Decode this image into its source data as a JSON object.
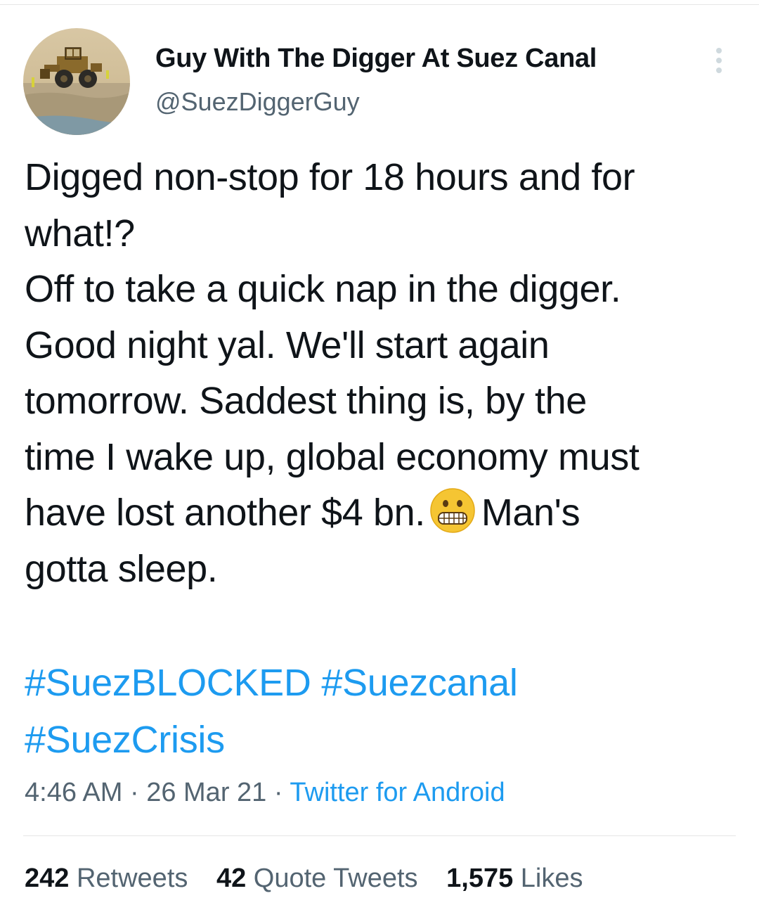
{
  "author": {
    "display_name": "Guy With The Digger At Suez Canal",
    "handle": "@SuezDiggerGuy",
    "avatar_icon": "digger-photo"
  },
  "tweet": {
    "lines": [
      "Digged non-stop for 18 hours and for",
      "what!?",
      "Off to take a quick nap in the digger.",
      "Good night yal. We'll start again",
      "tomorrow. Saddest thing is, by the",
      "time I wake up, global economy must"
    ],
    "line7_before": "have lost another $4 bn.",
    "emoji": "grimacing-face",
    "line7_after": "Man's",
    "line8": "gotta sleep.",
    "hashtags": [
      "#SuezBLOCKED",
      "#Suezcanal",
      "#SuezCrisis"
    ]
  },
  "meta": {
    "time": "4:46 AM",
    "separator": "·",
    "date": "26 Mar 21",
    "source": "Twitter for Android"
  },
  "stats": {
    "retweets_count": "242",
    "retweets_label": "Retweets",
    "quotes_count": "42",
    "quotes_label": "Quote Tweets",
    "likes_count": "1,575",
    "likes_label": "Likes"
  },
  "colors": {
    "link": "#1d9bf0",
    "secondary_text": "#536471",
    "primary_text": "#0f1419"
  }
}
